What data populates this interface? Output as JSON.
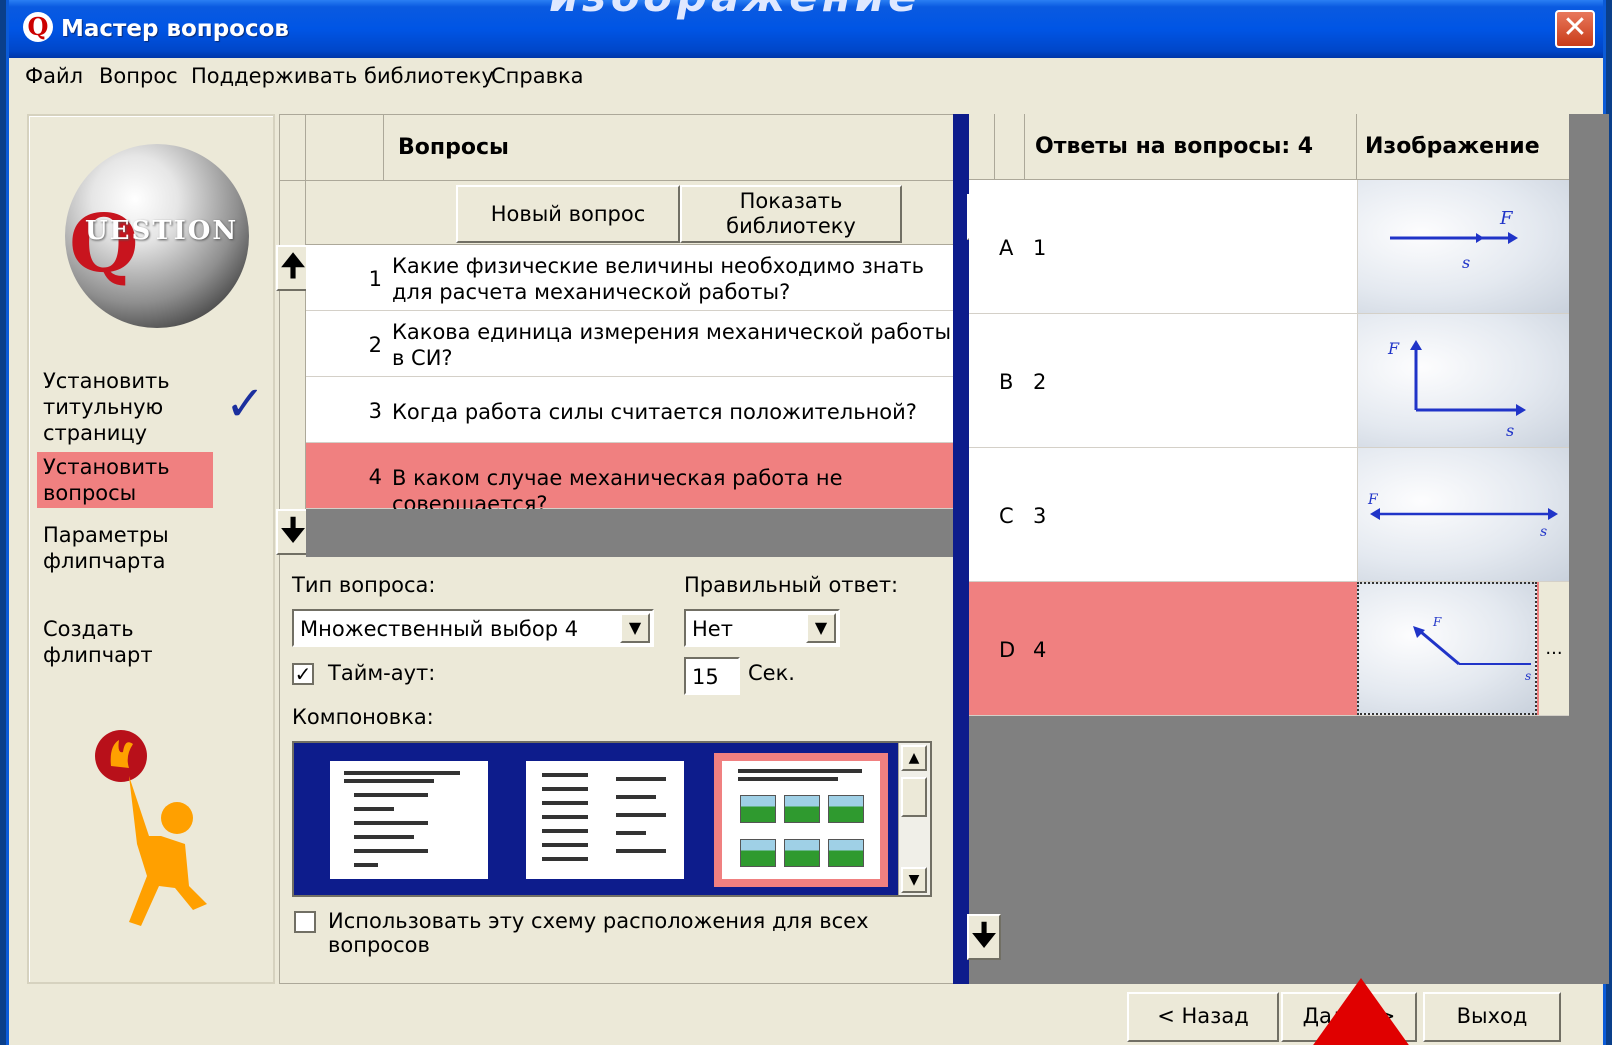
{
  "window": {
    "title": "Мастер вопросов",
    "watermark": "изображение"
  },
  "menu": [
    "Файл",
    "Вопрос",
    "Поддерживать библиотеку",
    "Справка"
  ],
  "logo": {
    "text": "UESTION",
    "letter": "Q"
  },
  "steps": [
    {
      "label": "Установить титульную страницу",
      "done": true
    },
    {
      "label": "Установить вопросы",
      "active": true
    },
    {
      "label": "Параметры флипчарта"
    },
    {
      "label": "Создать флипчарт"
    }
  ],
  "questions": {
    "header": "Вопросы",
    "new_button": "Новый вопрос",
    "library_button": "Показать библиотеку",
    "rows": [
      {
        "num": "1",
        "text": "Какие физические величины необходимо знать для расчета механической работы?"
      },
      {
        "num": "2",
        "text": "Какова единица измерения  механической работы в СИ?"
      },
      {
        "num": "3",
        "text": "Когда работа силы считается положительной?"
      },
      {
        "num": "4",
        "text": "В каком случае механическая работа не совершается?",
        "selected": true
      }
    ]
  },
  "form": {
    "type_label": "Тип вопроса:",
    "type_value": "Множественный выбор 4",
    "correct_label": "Правильный ответ:",
    "correct_value": "Нет",
    "timeout_label": "Тайм-аут:",
    "timeout_checked": true,
    "timeout_value": "15",
    "timeout_unit": "Сек.",
    "layout_label": "Компоновка:",
    "use_layout_label": "Использовать эту схему расположения для всех вопросов",
    "use_layout_checked": false
  },
  "answers": {
    "header": "Ответы на вопросы: 4",
    "image_header": "Изображение",
    "rows": [
      {
        "letter": "A",
        "text": "1",
        "force": "F",
        "displacement": "s"
      },
      {
        "letter": "B",
        "text": "2",
        "force": "F",
        "displacement": "s"
      },
      {
        "letter": "C",
        "text": "3",
        "force": "F",
        "displacement": "s"
      },
      {
        "letter": "D",
        "text": "4",
        "force": "F",
        "displacement": "s",
        "selected": true,
        "more": "..."
      }
    ]
  },
  "footer": {
    "back": "< Назад",
    "next": "Далее >",
    "exit": "Выход"
  },
  "colors": {
    "selection": "#f08080",
    "title_bar": "#0055e5",
    "layout_bg": "#0d1c8c"
  }
}
